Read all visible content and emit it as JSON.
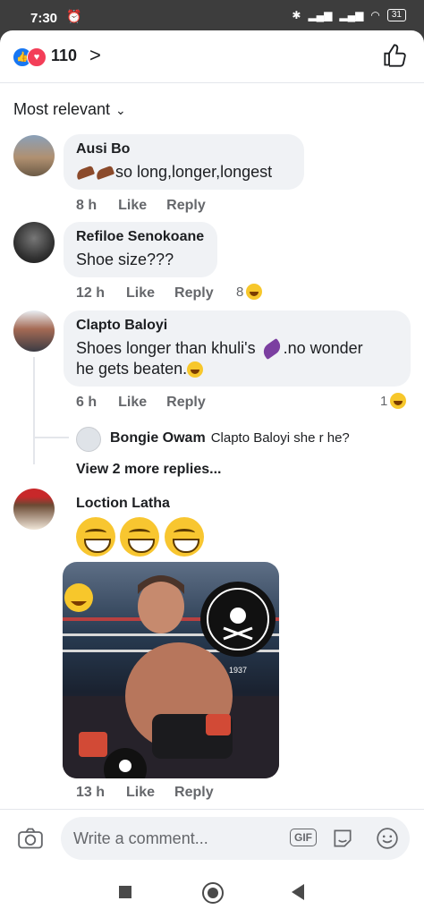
{
  "status_bar": {
    "time": "7:30",
    "battery": "31"
  },
  "header": {
    "reaction_count": "110"
  },
  "sort": {
    "label": "Most relevant"
  },
  "comments": [
    {
      "name": "Ausi Bo",
      "text": "so long,longer,longest",
      "time": "8 h",
      "like": "Like",
      "reply": "Reply"
    },
    {
      "name": "Refiloe Senokoane",
      "text": "Shoe size???",
      "time": "12 h",
      "like": "Like",
      "reply": "Reply",
      "reactions": "8"
    },
    {
      "name": "Clapto Baloyi",
      "text_1": "Shoes longer than khuli's",
      "text_2": ".no wonder",
      "text_3": "he gets beaten.",
      "time": "6 h",
      "like": "Like",
      "reply": "Reply",
      "reactions": "1"
    },
    {
      "name": "Loction Latha",
      "time": "13 h",
      "like": "Like",
      "reply": "Reply"
    }
  ],
  "reply_preview": {
    "name": "Bongie Owam",
    "text": "Clapto Baloyi she r he?"
  },
  "more_replies": "View 2 more replies...",
  "photo": {
    "badge_text": "1937"
  },
  "composer": {
    "placeholder": "Write a comment...",
    "gif": "GIF"
  }
}
